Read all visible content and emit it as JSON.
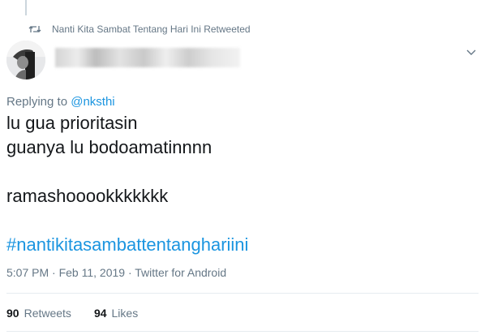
{
  "retweet_context": {
    "icon": "retweet-icon",
    "text": "Nanti Kita Sambat Tentang Hari Ini Retweeted"
  },
  "header": {
    "avatar_icon": "avatar-photo",
    "menu_icon": "chevron-down-icon"
  },
  "reply": {
    "prefix": "Replying to",
    "mention": "@nksthi"
  },
  "tweet": {
    "lines": [
      "lu gua prioritasin",
      "guanya lu bodoamatinnnn",
      "ramashooookkkkkkk"
    ],
    "hashtag": "#nantikitasambattentanghariini"
  },
  "meta": {
    "time": "5:07 PM",
    "separator1": "·",
    "date": "Feb 11, 2019",
    "separator2": "·",
    "source": "Twitter for Android"
  },
  "stats": {
    "retweets_count": "90",
    "retweets_label": "Retweets",
    "likes_count": "94",
    "likes_label": "Likes"
  },
  "colors": {
    "link": "#1b95e0",
    "muted": "#657786",
    "text": "#14171a",
    "divider": "#e6ecf0"
  }
}
